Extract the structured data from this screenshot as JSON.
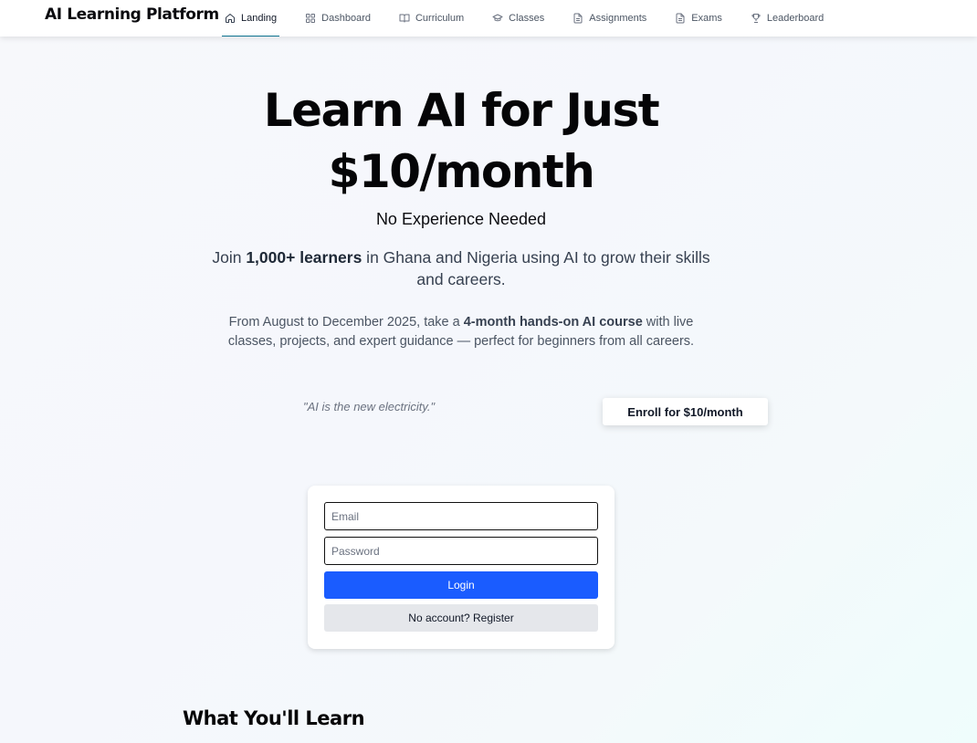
{
  "app": {
    "brand": "AI Learning Platform"
  },
  "nav": {
    "items": [
      {
        "label": "Landing",
        "icon": "home-icon",
        "active": true
      },
      {
        "label": "Dashboard",
        "icon": "dashboard-icon",
        "active": false
      },
      {
        "label": "Curriculum",
        "icon": "book-open-icon",
        "active": false
      },
      {
        "label": "Classes",
        "icon": "graduation-cap-icon",
        "active": false
      },
      {
        "label": "Assignments",
        "icon": "document-icon",
        "active": false
      },
      {
        "label": "Exams",
        "icon": "document-icon",
        "active": false
      },
      {
        "label": "Leaderboard",
        "icon": "trophy-icon",
        "active": false
      }
    ]
  },
  "hero": {
    "title_line1": "Learn AI for Just",
    "title_line2": "$10/month",
    "subtitle": "No Experience Needed",
    "join_prefix": "Join ",
    "join_bold": "1,000+ learners",
    "join_suffix": " in Ghana and Nigeria using AI to grow their skills and careers.",
    "course_prefix": "From August to December 2025, take a ",
    "course_bold": "4-month hands-on AI course",
    "course_suffix": " with live classes, projects, and expert guidance — perfect for beginners from all careers.",
    "quote": "\"AI is the new electricity.\"",
    "enroll_label": "Enroll for $10/month"
  },
  "login": {
    "email_placeholder": "Email",
    "email_value": "",
    "password_placeholder": "Password",
    "password_value": "",
    "login_label": "Login",
    "register_label": "No account? Register"
  },
  "sections": {
    "what_you_learn": "What You'll Learn"
  },
  "colors": {
    "accent": "#1a5cff",
    "nav_active_underline": "#0e7490",
    "register_bg": "#e5e7eb"
  }
}
